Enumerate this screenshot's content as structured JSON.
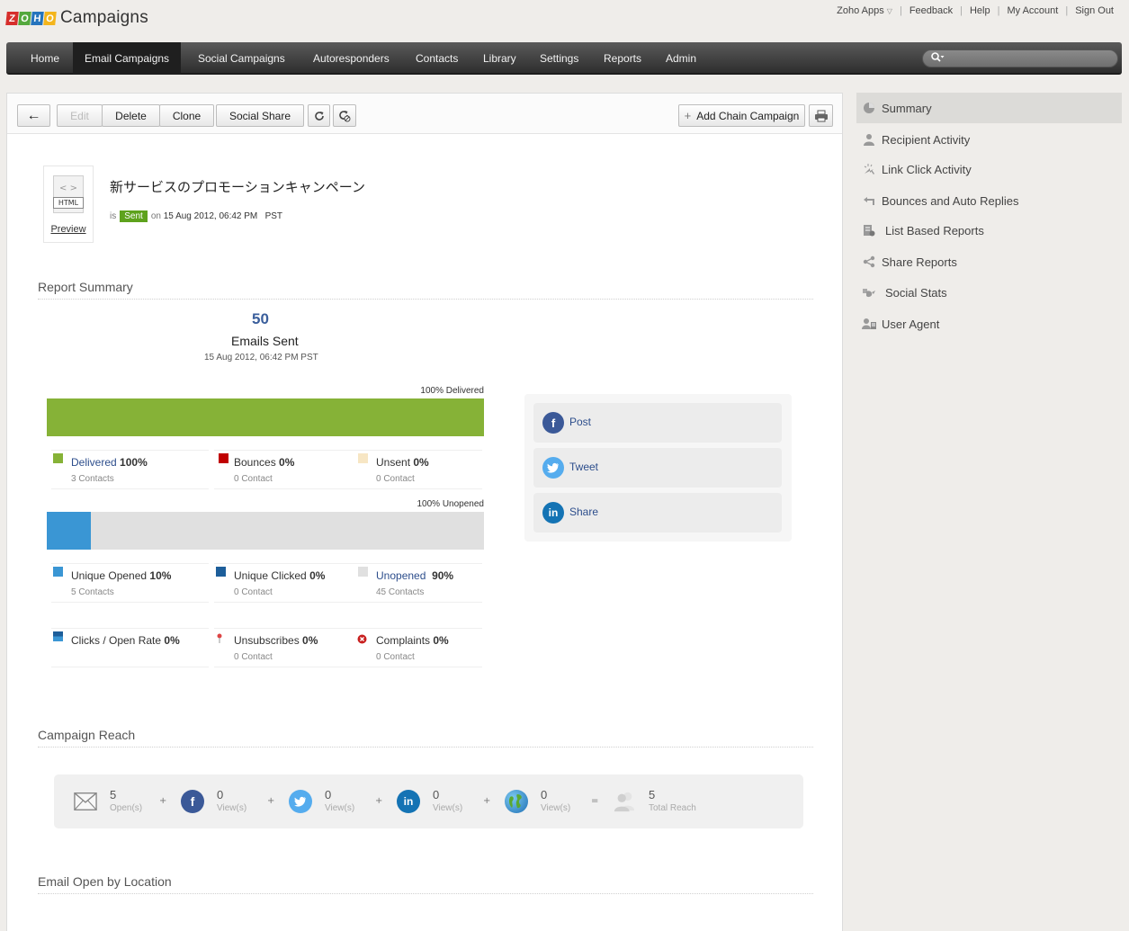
{
  "app": {
    "logo_letters": [
      "Z",
      "O",
      "H",
      "O"
    ],
    "logo_text": "Campaigns"
  },
  "top_links": {
    "zoho_apps": "Zoho Apps",
    "feedback": "Feedback",
    "help": "Help",
    "my_account": "My Account",
    "sign_out": "Sign Out"
  },
  "nav": {
    "home": "Home",
    "email_campaigns": "Email Campaigns",
    "social_campaigns": "Social Campaigns",
    "autoresponders": "Autoresponders",
    "contacts": "Contacts",
    "library": "Library",
    "settings": "Settings",
    "reports": "Reports",
    "admin": "Admin",
    "active": "Email Campaigns"
  },
  "toolbar": {
    "back_icon": "←",
    "edit": "Edit",
    "delete": "Delete",
    "clone": "Clone",
    "social_share": "Social Share",
    "add_chain": "Add Chain Campaign"
  },
  "campaign": {
    "thumb_code": "< >",
    "thumb_label": "HTML",
    "preview": "Preview",
    "title": "新サービスのプロモーションキャンペーン",
    "is": "is",
    "status": "Sent",
    "on": "on",
    "date": "15 Aug 2012, 06:42 PM",
    "tz": "PST"
  },
  "report_summary": {
    "title": "Report Summary",
    "emails_sent_count": "50",
    "emails_sent_label": "Emails Sent",
    "sent_date": "15 Aug 2012, 06:42 PM PST",
    "delivery_bar_label": "100% Delivered",
    "delivered_fraction": 1.0,
    "open_bar_label": "100% Unopened",
    "opened_fraction": 0.1,
    "delivered": {
      "name": "Delivered",
      "pct": "100%",
      "sub": "3 Contacts"
    },
    "bounces": {
      "name": "Bounces",
      "pct": "0%",
      "sub": "0 Contact"
    },
    "unsent": {
      "name": "Unsent",
      "pct": "0%",
      "sub": "0 Contact"
    },
    "unique_opened": {
      "name": "Unique Opened",
      "pct": "10%",
      "sub": "5 Contacts"
    },
    "unique_clicked": {
      "name": "Unique Clicked",
      "pct": "0%",
      "sub": "0 Contact"
    },
    "unopened": {
      "name": "Unopened",
      "pct": "90%",
      "sub": "45 Contacts"
    },
    "click_open_rate": {
      "name": "Clicks / Open Rate",
      "pct": "0%"
    },
    "unsubscribes": {
      "name": "Unsubscribes",
      "pct": "0%",
      "sub": "0 Contact"
    },
    "complaints": {
      "name": "Complaints",
      "pct": "0%",
      "sub": "0 Contact"
    }
  },
  "social_share": {
    "post": "Post",
    "tweet": "Tweet",
    "share": "Share"
  },
  "campaign_reach": {
    "title": "Campaign Reach",
    "email_val": "5",
    "email_unit": "Open(s)",
    "fb_val": "0",
    "fb_unit": "View(s)",
    "tw_val": "0",
    "tw_unit": "View(s)",
    "li_val": "0",
    "li_unit": "View(s)",
    "web_val": "0",
    "web_unit": "View(s)",
    "total_val": "5",
    "total_unit": "Total Reach",
    "plus": "+",
    "equals": "="
  },
  "location": {
    "title": "Email Open by Location"
  },
  "sidebar": {
    "summary": "Summary",
    "recipient_activity": "Recipient Activity",
    "link_click_activity": "Link Click Activity",
    "bounces_auto_replies": "Bounces and Auto Replies",
    "list_based_reports": "List Based Reports",
    "share_reports": "Share Reports",
    "social_stats": "Social Stats",
    "user_agent": "User Agent"
  },
  "colors": {
    "delivered": "#86b237",
    "bounces": "#c00000",
    "unsent": "#f7e6c4",
    "opened": "#3a96d4",
    "clicked": "#1d5e9a",
    "unopened_bar": "#e0e0e0",
    "sent_badge": "#5ea21d",
    "link": "#2d4e8c",
    "facebook": "#3b5998",
    "twitter": "#55acee",
    "linkedin": "#1473b4"
  }
}
